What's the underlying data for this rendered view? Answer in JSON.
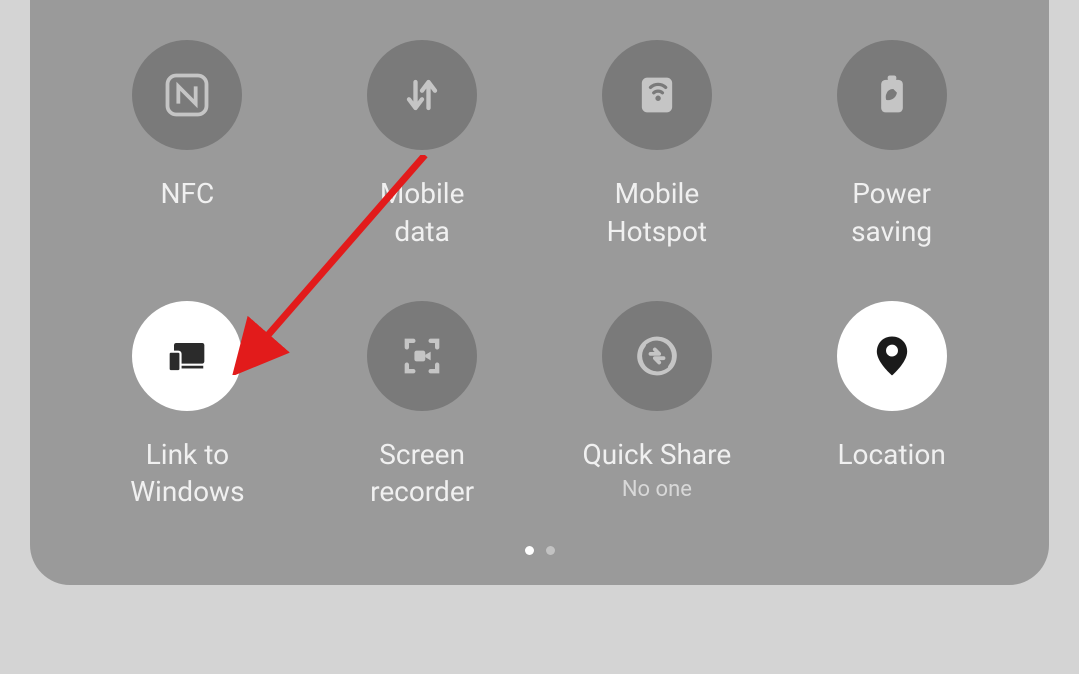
{
  "tiles": [
    {
      "id": "nfc",
      "label": "NFC",
      "active": false
    },
    {
      "id": "mobile-data",
      "label": "Mobile\ndata",
      "active": false
    },
    {
      "id": "mobile-hotspot",
      "label": "Mobile\nHotspot",
      "active": false
    },
    {
      "id": "power-saving",
      "label": "Power\nsaving",
      "active": false
    },
    {
      "id": "link-to-windows",
      "label": "Link to\nWindows",
      "active": true
    },
    {
      "id": "screen-recorder",
      "label": "Screen\nrecorder",
      "active": false
    },
    {
      "id": "quick-share",
      "label": "Quick Share",
      "sublabel": "No one",
      "active": false
    },
    {
      "id": "location",
      "label": "Location",
      "active": true
    }
  ],
  "labels": {
    "nfc": "NFC",
    "mobile_data_line1": "Mobile",
    "mobile_data_line2": "data",
    "mobile_hotspot_line1": "Mobile",
    "mobile_hotspot_line2": "Hotspot",
    "power_saving_line1": "Power",
    "power_saving_line2": "saving",
    "link_windows_line1": "Link to",
    "link_windows_line2": "Windows",
    "screen_recorder_line1": "Screen",
    "screen_recorder_line2": "recorder",
    "quick_share": "Quick Share",
    "quick_share_sub": "No one",
    "location": "Location"
  },
  "pagination": {
    "current": 1,
    "total": 2
  },
  "annotation": {
    "arrow_color": "#e21b1b"
  }
}
